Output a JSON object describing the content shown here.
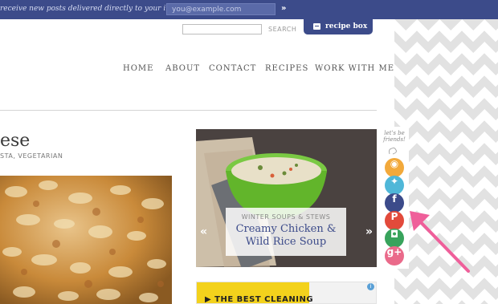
{
  "topbar": {
    "text": "receive new posts delivered directly to your inbox:",
    "email_placeholder": "you@example.com",
    "submit": "»"
  },
  "search": {
    "button": "SEARCH"
  },
  "recipe_box": {
    "label": "recipe box"
  },
  "nav": {
    "items": [
      "HOME",
      "ABOUT",
      "CONTACT",
      "RECIPES",
      "WORK WITH ME"
    ]
  },
  "post": {
    "title": "ese",
    "categories": "STA, VEGETARIAN"
  },
  "slider": {
    "kicker": "WINTER SOUPS & STEWS",
    "title_line1": "Creamy Chicken &",
    "title_line2": "Wild Rice Soup",
    "prev": "«",
    "next": "»"
  },
  "ad": {
    "text": "▶ THE BEST CLEANING",
    "info": "i"
  },
  "social": {
    "label": "let's be friends!",
    "icons": [
      {
        "name": "rss-icon",
        "glyph": "◉",
        "color": "#f2a93b"
      },
      {
        "name": "twitter-icon",
        "glyph": "✦",
        "color": "#4fb7d8"
      },
      {
        "name": "facebook-icon",
        "glyph": "f",
        "color": "#3c4b8a"
      },
      {
        "name": "pinterest-icon",
        "glyph": "P",
        "color": "#e24a3b"
      },
      {
        "name": "instagram-icon",
        "glyph": "◘",
        "color": "#38a35c"
      },
      {
        "name": "googleplus-icon",
        "glyph": "g+",
        "color": "#ea6a8a"
      }
    ],
    "arrow_color": "#ef5f9a"
  }
}
